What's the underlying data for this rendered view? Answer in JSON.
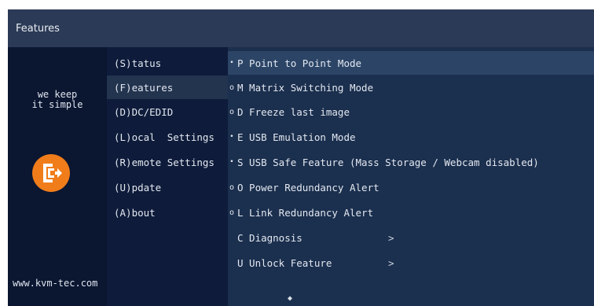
{
  "window": {
    "title": "Features"
  },
  "brand": {
    "tagline_line1": "we keep",
    "tagline_line2": "it simple",
    "website": "www.kvm-tec.com",
    "logo_color": "#f07d1a"
  },
  "menu": {
    "items": [
      {
        "label": "(S)tatus",
        "selected": false
      },
      {
        "label": "(F)eatures",
        "selected": true
      },
      {
        "label": "(D)DC/EDID",
        "selected": false
      },
      {
        "label": "(L)ocal  Settings",
        "selected": false
      },
      {
        "label": "(R)emote Settings",
        "selected": false
      },
      {
        "label": "(U)pdate",
        "selected": false
      },
      {
        "label": "(A)bout",
        "selected": false
      }
    ]
  },
  "features": {
    "options": [
      {
        "bullet": "•",
        "label": "P Point to Point Mode"
      },
      {
        "bullet": "o",
        "label": "M Matrix Switching Mode"
      },
      {
        "bullet": "o",
        "label": "D Freeze last image"
      },
      {
        "bullet": "•",
        "label": "E USB Emulation Mode"
      },
      {
        "bullet": "•",
        "label": "S USB Safe Feature (Mass Storage / Webcam disabled)"
      },
      {
        "bullet": "o",
        "label": "O Power Redundancy Alert"
      },
      {
        "bullet": "o",
        "label": "L Link Redundancy Alert"
      }
    ],
    "submenus": [
      {
        "label": "C Diagnosis",
        "chevron": ">"
      },
      {
        "label": "U Unlock Feature",
        "chevron": ">"
      }
    ],
    "scroll_indicator": "◆"
  }
}
